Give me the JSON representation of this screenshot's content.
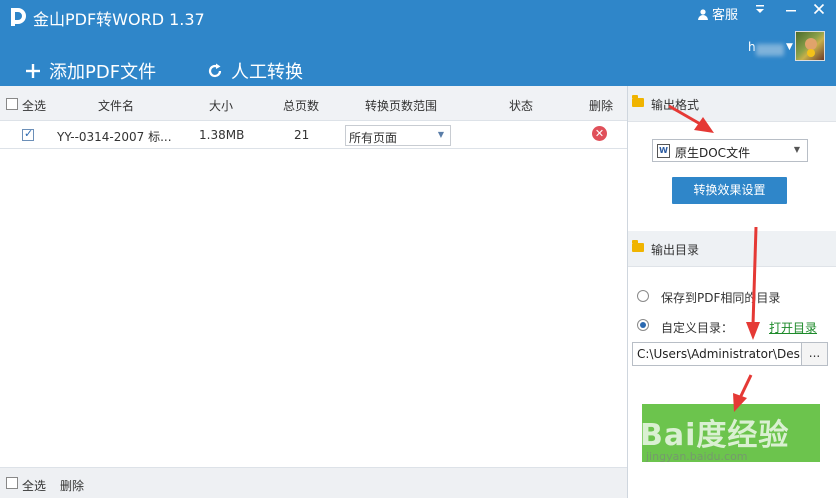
{
  "app": {
    "title": "金山PDF转WORD 1.37",
    "service_label": "客服",
    "user_name": "h"
  },
  "toolbar": {
    "add_pdf_label": "添加PDF文件",
    "manual_convert_label": "人工转换"
  },
  "table": {
    "select_all_label": "全选",
    "columns": [
      "文件名",
      "大小",
      "总页数",
      "转换页数范围",
      "状态",
      "删除"
    ],
    "rows": [
      {
        "checked": true,
        "file_name": "YY--0314-2007 标...",
        "size": "1.38MB",
        "pages": "21",
        "range": "所有页面",
        "status": ""
      }
    ]
  },
  "bottom": {
    "select_all_label": "全选",
    "delete_label": "删除"
  },
  "output_format": {
    "title": "输出格式",
    "selected": "原生DOC文件",
    "settings_button": "转换效果设置"
  },
  "output_dir": {
    "title": "输出目录",
    "option_same": "保存到PDF相同的目录",
    "option_custom": "自定义目录：",
    "selected": "custom",
    "open_link": "打开目录",
    "path": "C:\\Users\\Administrator\\Desktop",
    "browse_label": "..."
  },
  "watermark": {
    "brand": "Bai度经验",
    "url": "jingyan.baidu.com"
  },
  "colors": {
    "header_blue": "#2f86c9",
    "start_green": "#6cc44d",
    "annotation_red": "#e53935",
    "link_green": "#1d8a2a"
  }
}
